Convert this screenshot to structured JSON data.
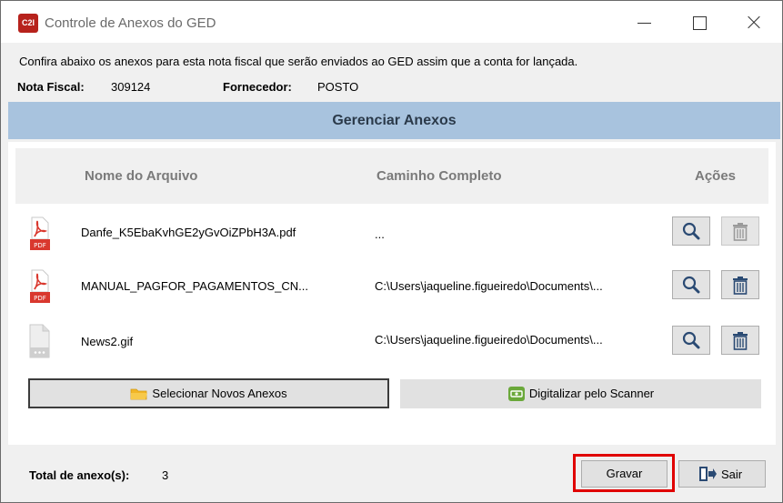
{
  "window": {
    "logo_text": "C2I",
    "title": "Controle de Anexos do GED"
  },
  "info": {
    "message": "Confira abaixo os anexos para esta nota fiscal que serão enviados ao GED assim que a conta for lançada.",
    "nota_fiscal_label": "Nota Fiscal:",
    "nota_fiscal_value": "309124",
    "fornecedor_label": "Fornecedor:",
    "fornecedor_value": "POSTO"
  },
  "section": {
    "title": "Gerenciar Anexos"
  },
  "table": {
    "headers": {
      "nome": "Nome do Arquivo",
      "caminho": "Caminho Completo",
      "acoes": "Ações"
    },
    "rows": [
      {
        "icon": "pdf-file-icon",
        "nome": "Danfe_K5EbaKvhGE2yGvOiZPbH3A.pdf",
        "caminho": "...",
        "delete_enabled": false
      },
      {
        "icon": "pdf-file-icon",
        "nome": "MANUAL_PAGFOR_PAGAMENTOS_CN...",
        "caminho": "C:\\Users\\jaqueline.figueiredo\\Documents\\...",
        "delete_enabled": true
      },
      {
        "icon": "generic-file-icon",
        "nome": "News2.gif",
        "caminho": "C:\\Users\\jaqueline.figueiredo\\Documents\\...",
        "delete_enabled": true
      }
    ]
  },
  "actions": {
    "select_label": "Selecionar Novos Anexos",
    "scan_label": "Digitalizar pelo Scanner"
  },
  "footer": {
    "total_label": "Total de anexo(s):",
    "total_value": "3",
    "save_label": "Gravar",
    "exit_label": "Sair"
  },
  "colors": {
    "header_band": "#a8c3de",
    "pdf_red": "#d9382e",
    "highlight_red": "#e00000",
    "scanner_green": "#6aa83a",
    "folder_yellow": "#f2b627"
  }
}
